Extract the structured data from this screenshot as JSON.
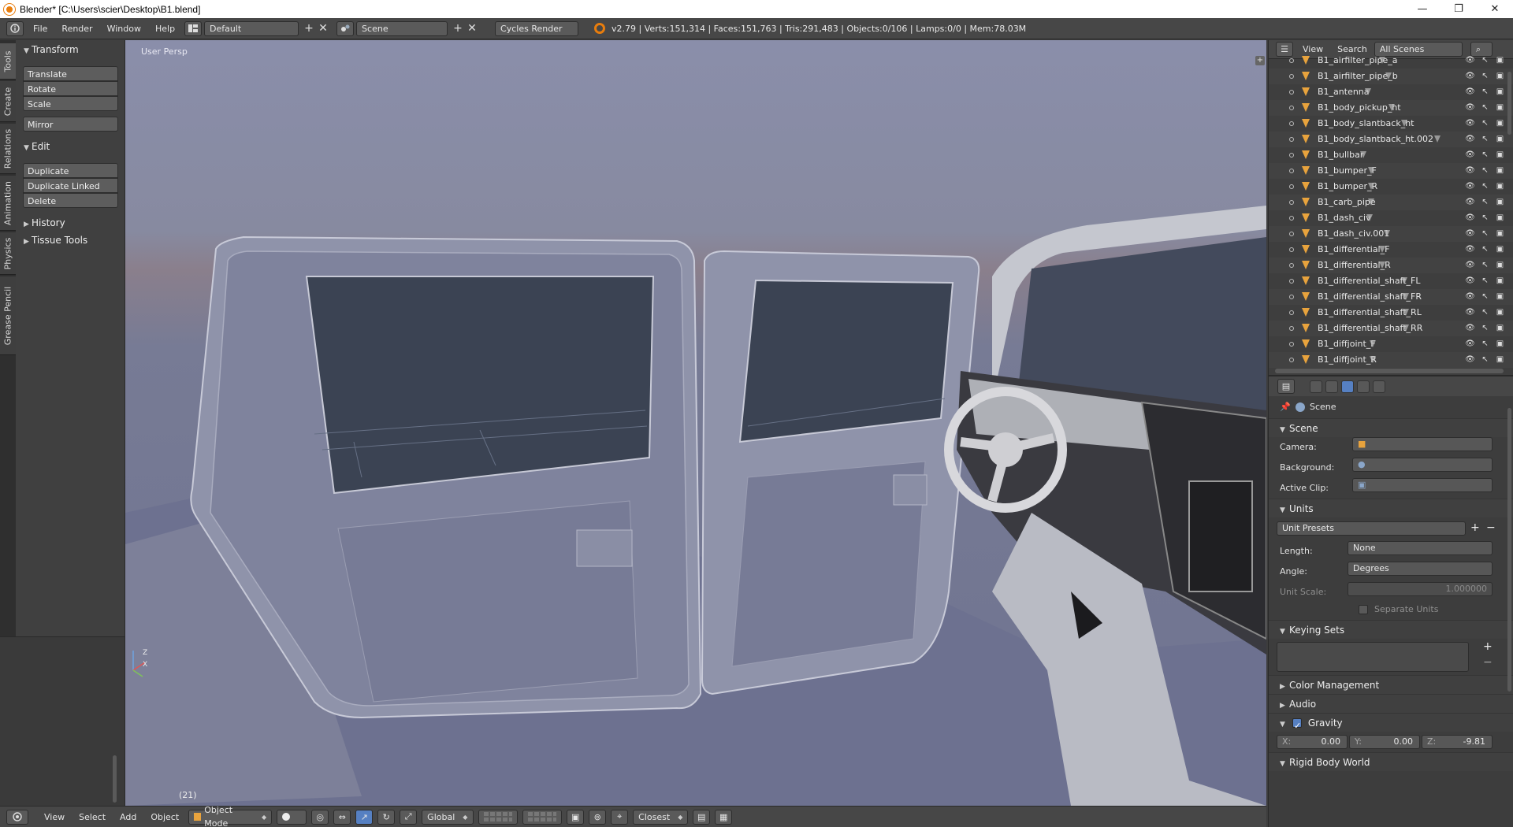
{
  "window": {
    "title": "Blender* [C:\\Users\\scier\\Desktop\\B1.blend]",
    "controls": [
      "—",
      "❐",
      "✕"
    ]
  },
  "info_header": {
    "menus": [
      "File",
      "Render",
      "Window",
      "Help"
    ],
    "screen_layout": "Default",
    "scene": "Scene",
    "render_engine": "Cycles Render",
    "stats": "v2.79 | Verts:151,314 | Faces:151,763 | Tris:291,483 | Objects:0/106 | Lamps:0/0 | Mem:78.03M"
  },
  "vertical_tabs": [
    "Tools",
    "Create",
    "Relations",
    "Animation",
    "Physics",
    "Grease Pencil"
  ],
  "toolshelf": {
    "transform_title": "Transform",
    "translate": "Translate",
    "rotate": "Rotate",
    "scale": "Scale",
    "mirror": "Mirror",
    "edit_title": "Edit",
    "duplicate": "Duplicate",
    "duplicate_linked": "Duplicate Linked",
    "delete": "Delete",
    "history": "History",
    "tissue_tools": "Tissue Tools"
  },
  "viewport": {
    "label": "User Persp",
    "frame": "(21)"
  },
  "viewport_footer": {
    "menus": [
      "View",
      "Select",
      "Add",
      "Object"
    ],
    "mode": "Object Mode",
    "orientation": "Global",
    "snap_target": "Closest"
  },
  "outliner": {
    "view": "View",
    "search": "Search",
    "display_mode": "All Scenes",
    "items": [
      "B1_airfilter_pipe_a",
      "B1_airfilter_pipe_b",
      "B1_antenna",
      "B1_body_pickup_ht",
      "B1_body_slantback_ht",
      "B1_body_slantback_ht.002",
      "B1_bullbar",
      "B1_bumper_F",
      "B1_bumper_R",
      "B1_carb_pipe",
      "B1_dash_civ",
      "B1_dash_civ.001",
      "B1_differential_F",
      "B1_differential_R",
      "B1_differential_shaft_FL",
      "B1_differential_shaft_FR",
      "B1_differential_shaft_RL",
      "B1_differential_shaft_RR",
      "B1_diffjoint_F",
      "B1_diffjoint_R"
    ]
  },
  "properties": {
    "context": "Scene",
    "scene_section": "Scene",
    "camera_label": "Camera:",
    "background_label": "Background:",
    "active_clip_label": "Active Clip:",
    "units_section": "Units",
    "unit_presets": "Unit Presets",
    "length_label": "Length:",
    "length_value": "None",
    "angle_label": "Angle:",
    "angle_value": "Degrees",
    "unit_scale_label": "Unit Scale:",
    "unit_scale_value": "1.000000",
    "separate_units": "Separate Units",
    "keying_sets_section": "Keying Sets",
    "color_management": "Color Management",
    "audio": "Audio",
    "gravity": "Gravity",
    "gravity_x_label": "X:",
    "gravity_x": "0.00",
    "gravity_y_label": "Y:",
    "gravity_y": "0.00",
    "gravity_z_label": "Z:",
    "gravity_z": "-9.81",
    "rigid_body_world": "Rigid Body World"
  },
  "colors": {
    "viewport_bg": "#7b7f99",
    "accent_blue": "#5680c2",
    "object_icon": "#e8a33d"
  }
}
